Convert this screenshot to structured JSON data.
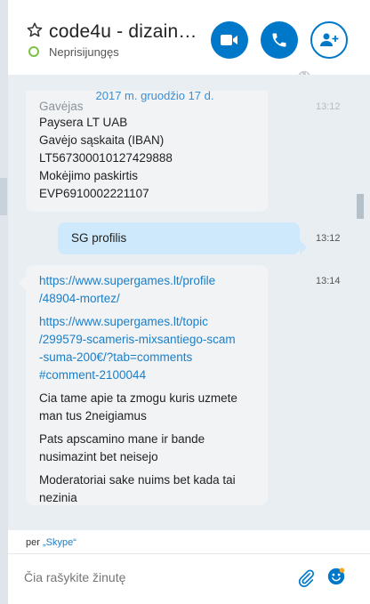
{
  "header": {
    "title": "code4u - dizain…",
    "status": "Neprisijungęs",
    "status_color": "#7cc242"
  },
  "chat": {
    "date_divider": "2017 m. gruodžio 17 d.",
    "messages": [
      {
        "direction": "incoming",
        "time": "13:12",
        "lines": [
          "Gavėjas",
          "Paysera LT UAB",
          "Gavėjo sąskaita (IBAN)",
          "LT567300010127429888",
          "Mokėjimo paskirtis",
          "EVP6910002221107"
        ]
      },
      {
        "direction": "outgoing",
        "time": "13:12",
        "text": "SG profilis"
      },
      {
        "direction": "incoming",
        "time": "13:14",
        "link1": [
          "https://www.supergames.lt/profile",
          "/48904-mortez/"
        ],
        "link2": [
          "https://www.supergames.lt/topic",
          "/299579-scameris-mixsantiego-scam",
          "-suma-200€/?tab=comments",
          "#comment-2100044"
        ],
        "p1": [
          "Cia tame apie ta zmogu kuris uzmete",
          "man tus 2neigiamus"
        ],
        "p2": [
          "Pats apscamino mane ir bande",
          "nusimazint bet neisejo"
        ],
        "p3": [
          "Moderatoriai sake nuims bet kada tai",
          "nezinia"
        ]
      }
    ]
  },
  "footer": {
    "via_prefix": "per ",
    "via_name": "„Skype“",
    "input_placeholder": "Čia rašykite žinutę"
  },
  "colors": {
    "accent": "#0078ca",
    "link": "#1a7fc8",
    "outgoing_bubble": "#cde9fb",
    "incoming_bubble": "#f1f3f5",
    "chat_bg": "#e9eef2"
  },
  "icons": [
    "star-icon",
    "video-icon",
    "phone-icon",
    "add-contact-icon",
    "globe-icon",
    "attach-icon",
    "emoji-icon"
  ]
}
